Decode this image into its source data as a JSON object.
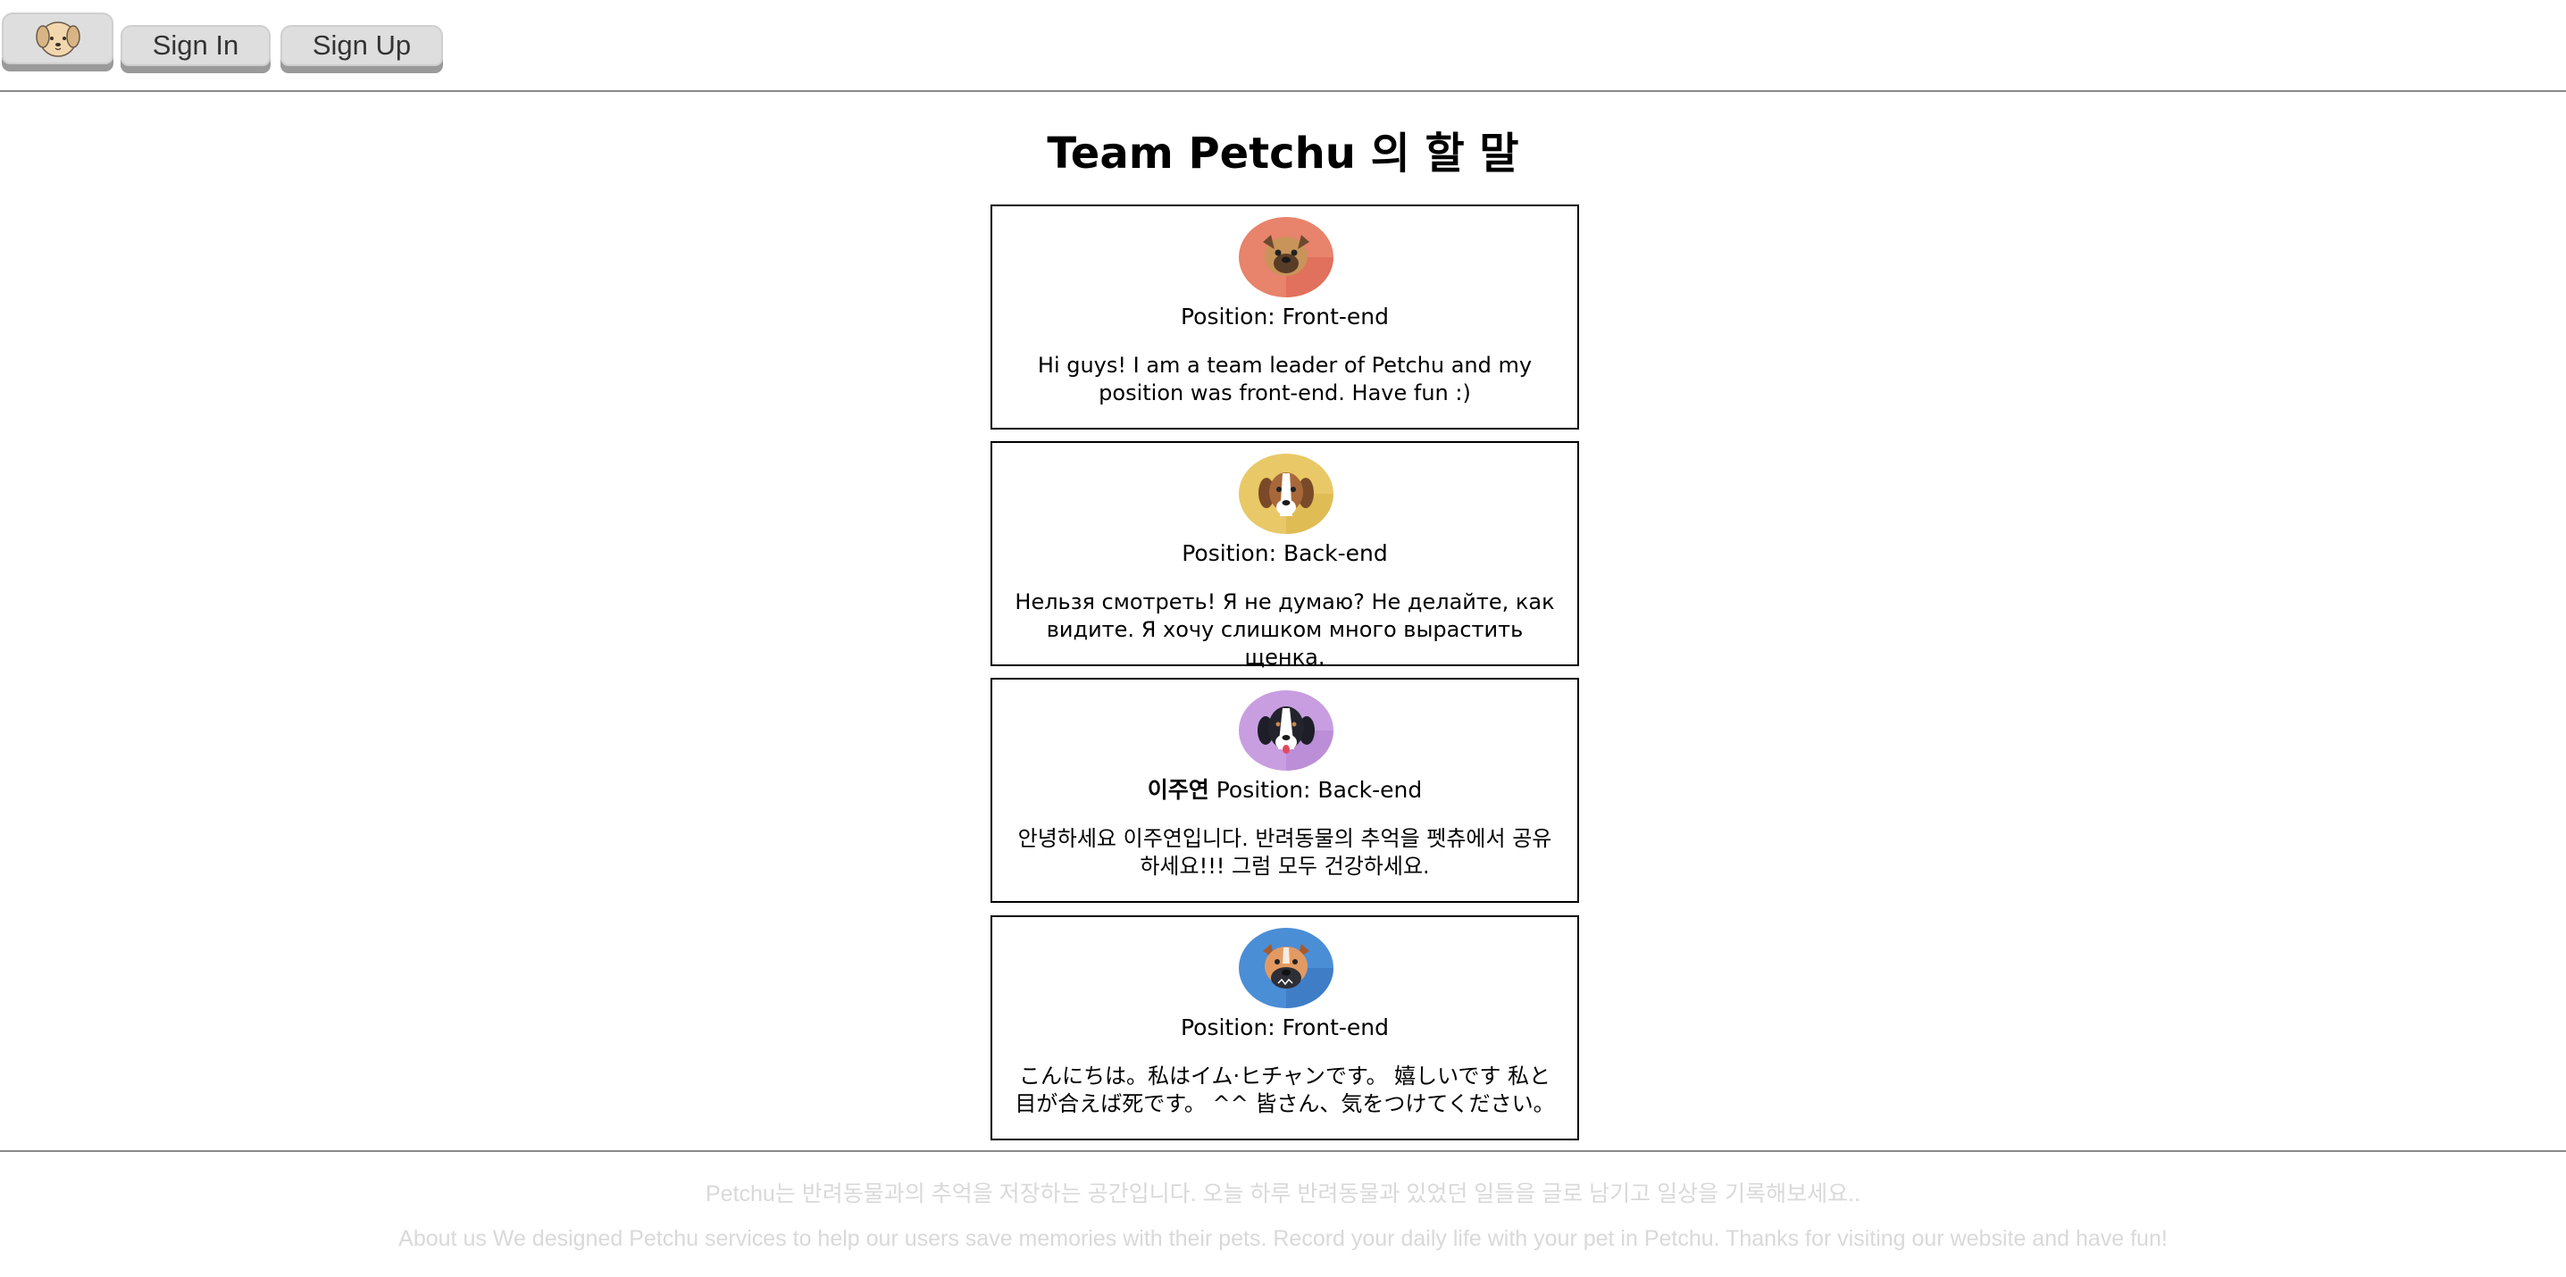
{
  "header": {
    "logo_icon": "puppy-face-icon",
    "sign_in_label": "Sign In",
    "sign_up_label": "Sign Up"
  },
  "main": {
    "title": "Team Petchu 의 할 말",
    "members": [
      {
        "avatar_icon": "pug-avatar-icon",
        "avatar_color": "#e8836c",
        "name": "",
        "position": "Position: Front-end",
        "message": "Hi guys! I am a team leader of Petchu and my position was front-end. Have fun :)"
      },
      {
        "avatar_icon": "beagle-avatar-icon",
        "avatar_color": "#e9c867",
        "name": "",
        "position": "Position: Back-end",
        "message": "Нельзя смотреть! Я не думаю? Не делайте, как видите. Я хочу слишком много вырастить щенка."
      },
      {
        "avatar_icon": "bernese-avatar-icon",
        "avatar_color": "#c89ee0",
        "name": "이주연",
        "position": "Position: Back-end",
        "message": "안녕하세요 이주연입니다. 반려동물의 추억을 펫츄에서 공유하세요!!! 그럼 모두 건강하세요."
      },
      {
        "avatar_icon": "boxer-avatar-icon",
        "avatar_color": "#4a8ed6",
        "name": "",
        "position": "Position: Front-end",
        "message": "こんにちは。私はイム·ヒチャンです。 嬉しいです 私と目が合えば死です。 ^^ 皆さん、気をつけてください。"
      }
    ]
  },
  "footer": {
    "korean_text": "Petchu는 반려동물과의 추억을 저장하는 공간입니다. 오늘 하루 반려동물과 있었던 일들을 글로 남기고 일상을 기록해보세요..",
    "english_text": "About us We designed Petchu services to help our users save memories with their pets. Record your daily life with your pet in Petchu. Thanks for visiting our website and have fun!"
  }
}
